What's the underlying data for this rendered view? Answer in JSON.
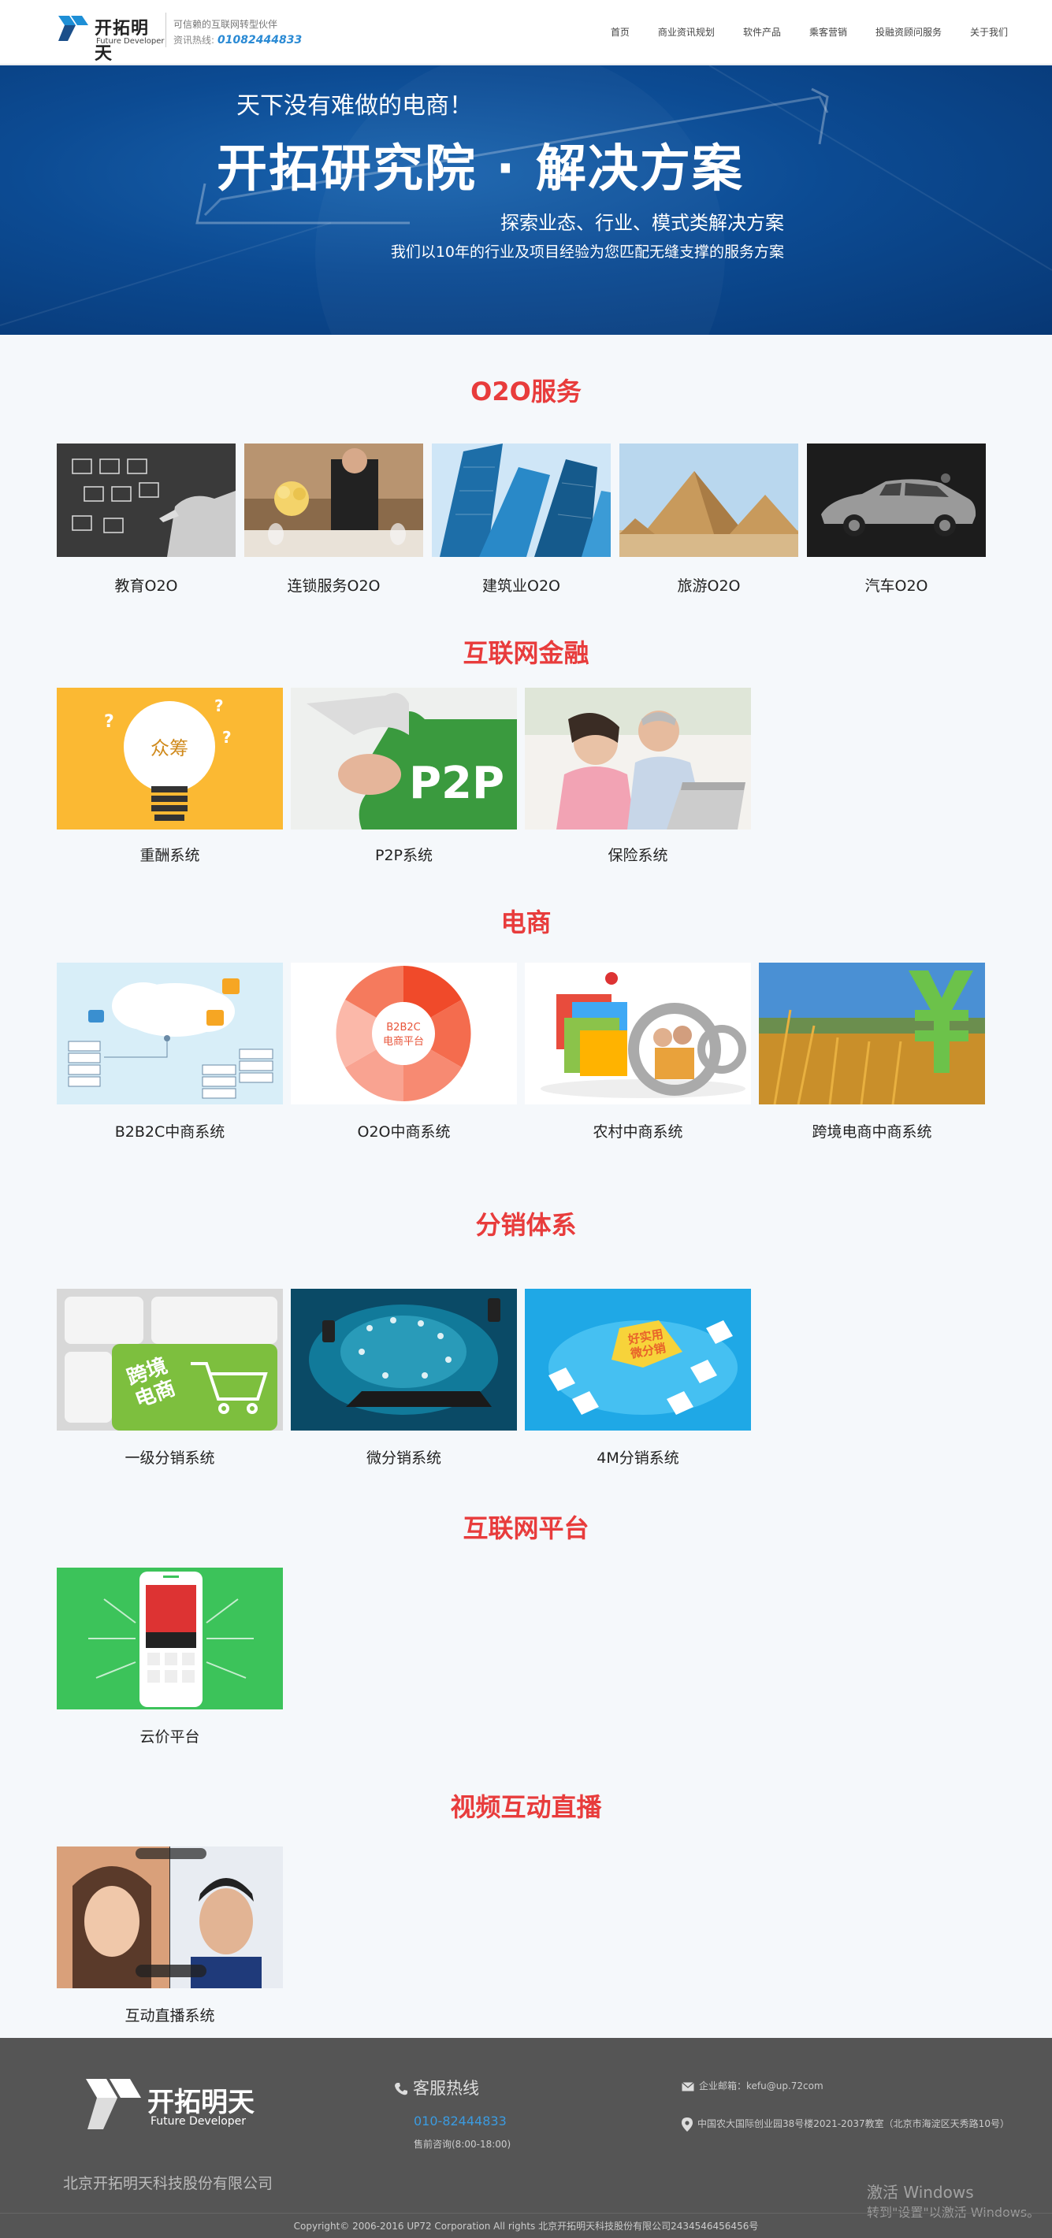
{
  "header": {
    "logo_cn": "开拓明天",
    "logo_en": "Future Developer",
    "slogan": "可信赖的互联网转型伙伴",
    "hotline_label": "资讯热线:",
    "hotline_number": "01082444833",
    "nav": [
      "首页",
      "商业资讯规划",
      "软件产品",
      "乘客营销",
      "投融资顾问服务",
      "关于我们"
    ]
  },
  "banner": {
    "line1": "天下没有难做的电商！",
    "title": "开拓研究院 · 解决方案",
    "subtitle": "探索业态、行业、模式类解决方案",
    "desc": "我们以10年的行业及项目经验为您匹配无缝支撑的服务方案"
  },
  "sections": [
    {
      "title": "O2O服务",
      "items": [
        "教育O2O",
        "连锁服务O2O",
        "建筑业O2O",
        "旅游O2O",
        "汽车O2O"
      ]
    },
    {
      "title": "互联网金融",
      "items": [
        "重酬系统",
        "P2P系统",
        "保险系统"
      ]
    },
    {
      "title": "电商",
      "items": [
        "B2B2C中商系统",
        "O2O中商系统",
        "农村中商系统",
        "跨境电商中商系统"
      ]
    },
    {
      "title": "分销体系",
      "items": [
        "一级分销系统",
        "微分销系统",
        "4M分销系统"
      ]
    },
    {
      "title": "互联网平台",
      "items": [
        "云价平台"
      ]
    },
    {
      "title": "视频互动直播",
      "items": [
        "互动直播系统"
      ]
    }
  ],
  "thumb_text": {
    "bulb": "众筹",
    "p2p": "P2P",
    "b2b2c": "B2B2C\n电商平台",
    "kuajing": "跨境\n电商",
    "fenxiao": "好实用\n微分销"
  },
  "footer": {
    "logo_cn": "开拓明天",
    "logo_en": "Future Developer",
    "company": "北京开拓明天科技股份有限公司",
    "hotline_title": "客服热线",
    "hotline_number": "010-82444833",
    "hours": "售前咨询(8:00-18:00)",
    "mail": "企业邮箱：kefu@up.72com",
    "address": "中国农大国际创业园38号楼2021-2037教室（北京市海淀区天秀路10号）",
    "copyright": "Copyright© 2006-2016 UP72 Corporation All rights 北京开拓明天科技股份有限公司2434546456456号",
    "watermark_line1": "激活 Windows",
    "watermark_line2": "转到\"设置\"以激活 Windows。"
  },
  "colors": {
    "accent_red": "#e83c3c",
    "link_blue": "#2a8ad4",
    "banner_blue": "#0c4b93",
    "footer_bg": "#555555"
  }
}
